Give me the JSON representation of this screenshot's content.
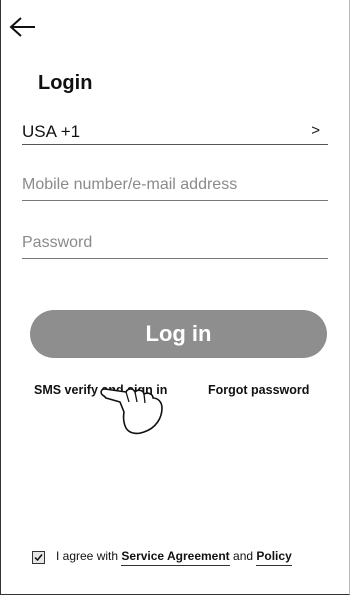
{
  "header": {
    "back_icon": "arrow-left-icon",
    "title": "Login"
  },
  "country": {
    "value": "USA +1",
    "chevron": ">"
  },
  "fields": {
    "mobile_placeholder": "Mobile number/e-mail address",
    "password_placeholder": "Password"
  },
  "actions": {
    "login_label": "Log in",
    "sms_label": "SMS verify and sign in",
    "forgot_label": "Forgot password",
    "pointer_icon": "hand-pointer-icon"
  },
  "agreement": {
    "checked": true,
    "prefix": "I agree with",
    "service_label": "Service Agreement",
    "and_text": "and",
    "policy_label": "Policy"
  },
  "colors": {
    "button": "#8e8e8e",
    "button_text": "#ffffff"
  }
}
